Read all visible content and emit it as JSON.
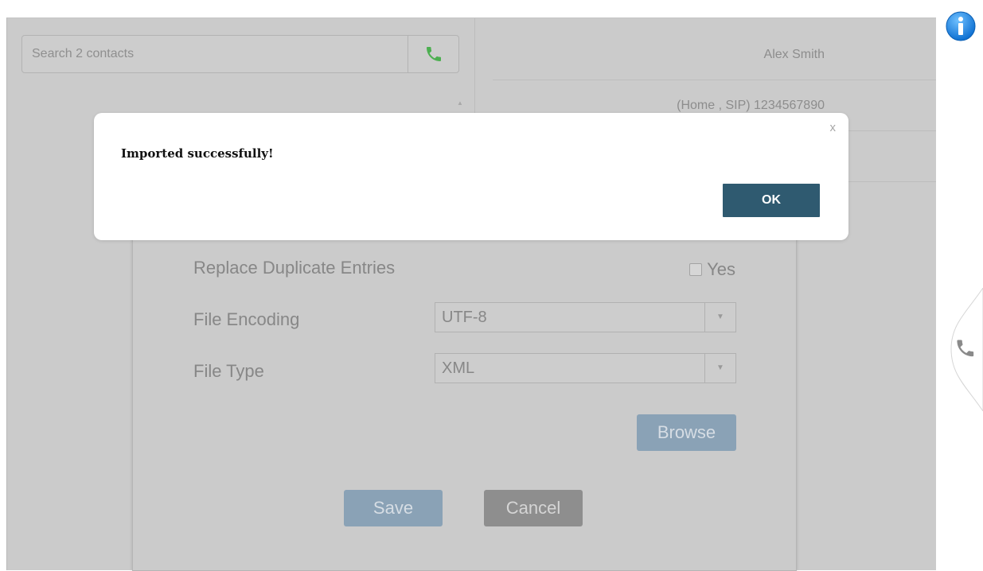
{
  "search": {
    "placeholder": "Search 2 contacts"
  },
  "contact": {
    "name": "Alex Smith",
    "phone": "(Home , SIP) 1234567890"
  },
  "import_dialog": {
    "replace_duplicates_label": "Replace Duplicate Entries",
    "replace_duplicates_option": "Yes",
    "replace_duplicates_checked": false,
    "file_encoding_label": "File Encoding",
    "file_encoding_value": "UTF-8",
    "file_type_label": "File Type",
    "file_type_value": "XML",
    "browse_label": "Browse",
    "save_label": "Save",
    "cancel_label": "Cancel"
  },
  "alert": {
    "message": "Imported successfully!",
    "close_label": "x",
    "ok_label": "OK"
  },
  "colors": {
    "ok_button": "#2f5a70",
    "primary_disabled": "#8aa2b6",
    "phone_icon_green": "#4caf50",
    "info_blue": "#1e88e5"
  },
  "icons": {
    "search_call": "phone-icon",
    "info": "info-icon",
    "side_call": "phone-icon",
    "scroll": "scroll-up-icon",
    "dropdown": "chevron-down-icon"
  }
}
